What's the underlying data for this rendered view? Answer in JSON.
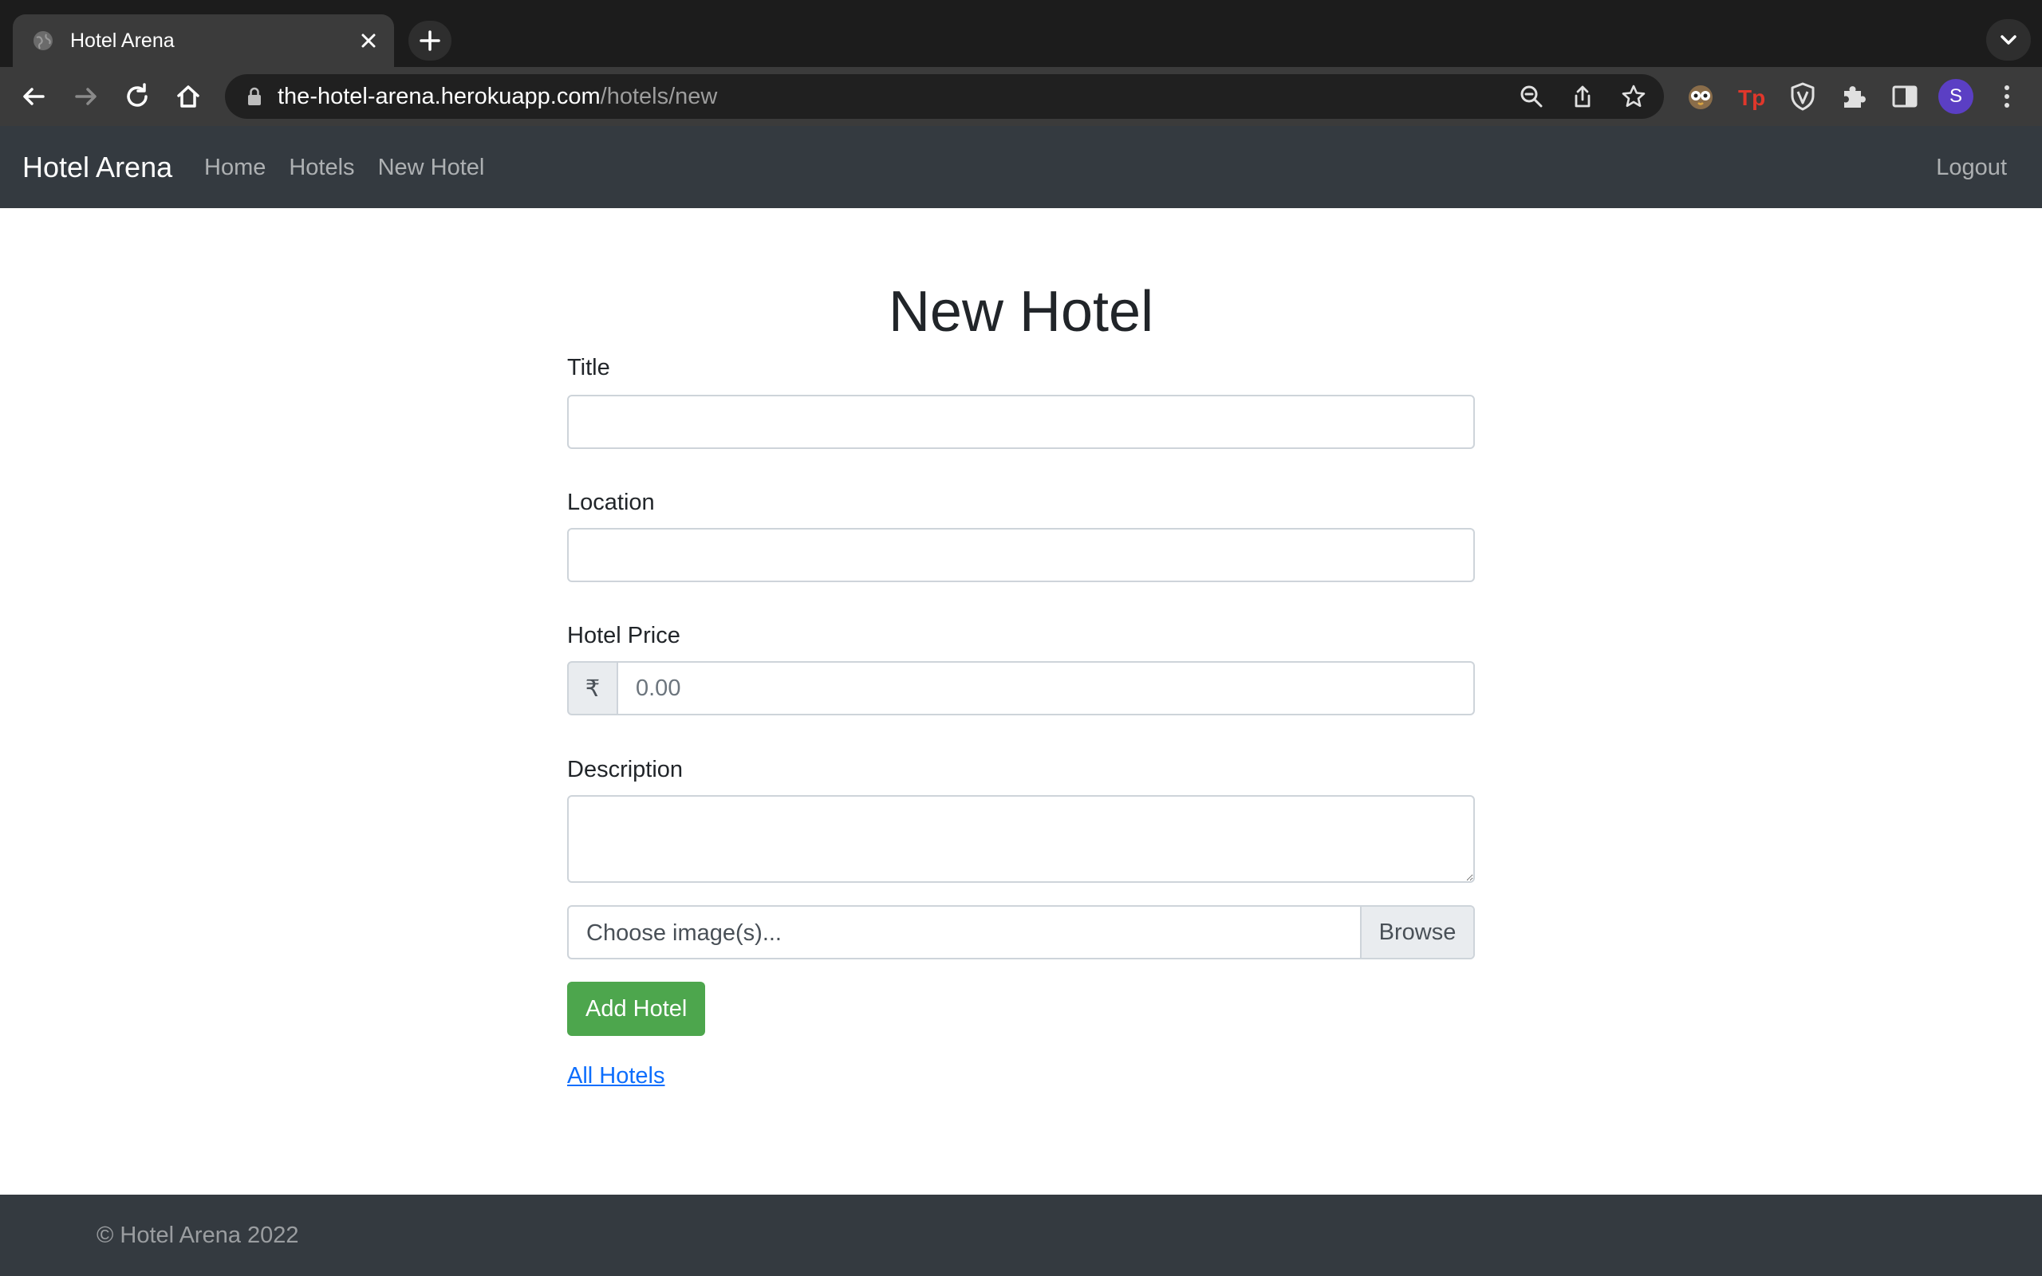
{
  "browser": {
    "tab_title": "Hotel Arena",
    "url_host": "the-hotel-arena.herokuapp.com",
    "url_path": "/hotels/new",
    "profile_initial": "S"
  },
  "navbar": {
    "brand": "Hotel Arena",
    "links": [
      "Home",
      "Hotels",
      "New Hotel"
    ],
    "logout": "Logout"
  },
  "form": {
    "heading": "New Hotel",
    "title_label": "Title",
    "location_label": "Location",
    "price_label": "Hotel Price",
    "currency_symbol": "₹",
    "price_placeholder": "0.00",
    "description_label": "Description",
    "file_placeholder": "Choose image(s)...",
    "browse_label": "Browse",
    "submit_label": "Add Hotel",
    "all_hotels_link": "All Hotels"
  },
  "footer": {
    "copyright": "© Hotel Arena 2022"
  },
  "colors": {
    "navbar_bg": "#343a40",
    "submit_bg": "#4da64d",
    "link": "#0d6efd"
  }
}
